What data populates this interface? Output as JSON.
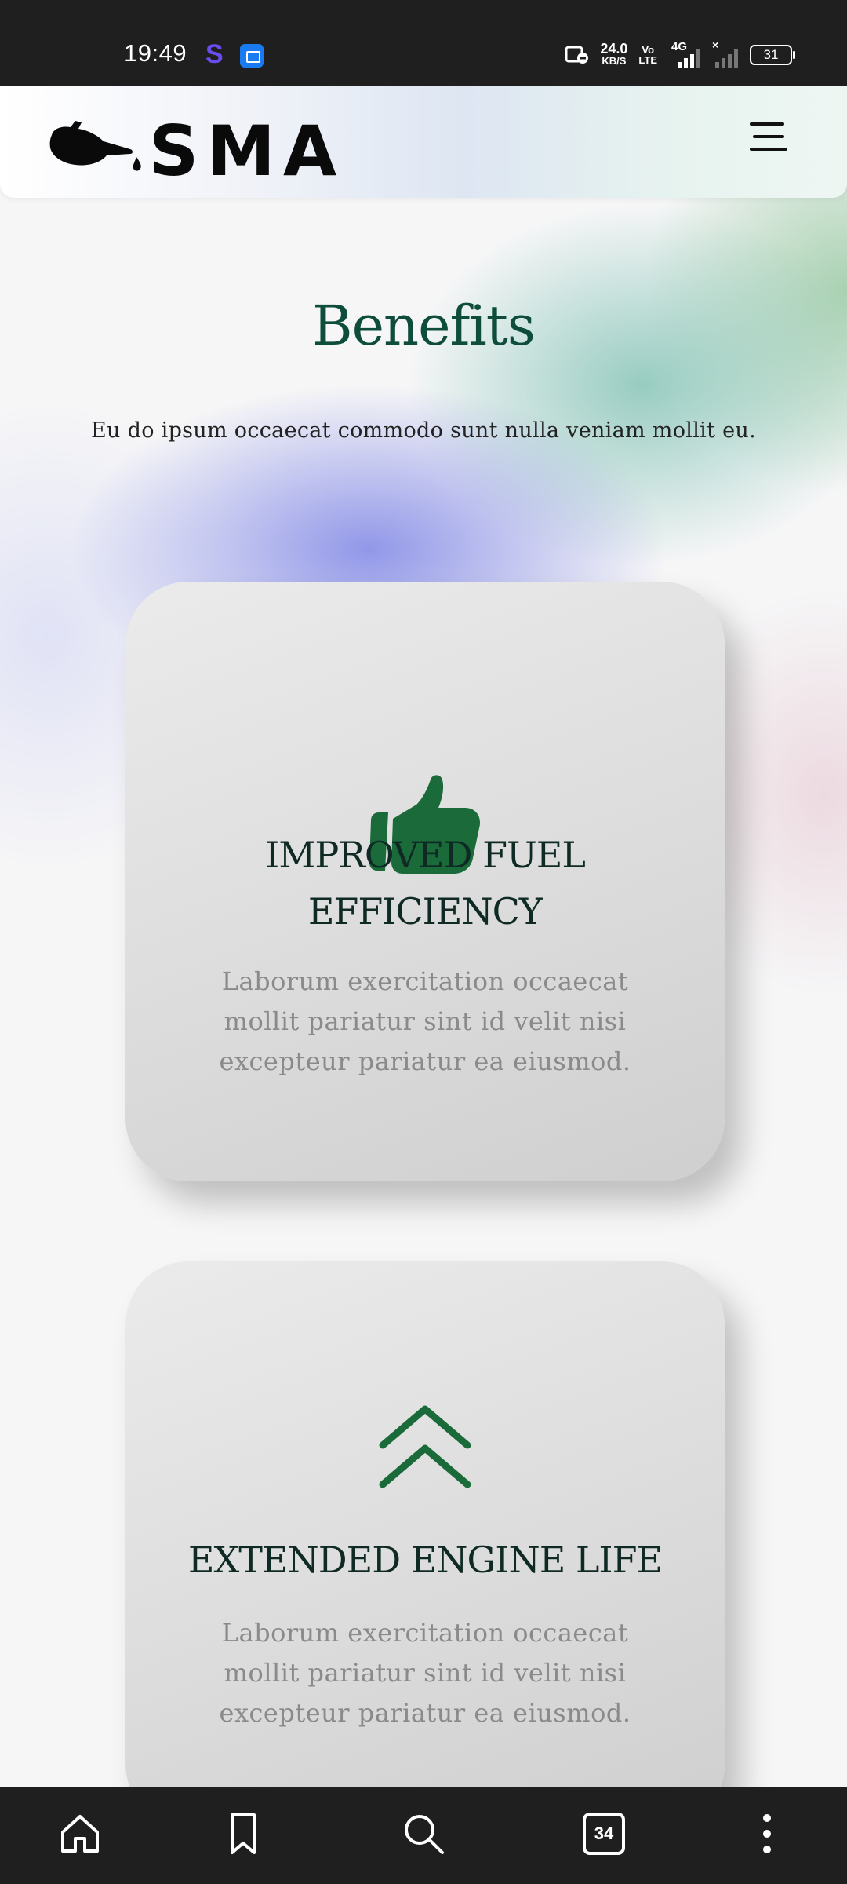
{
  "status_bar": {
    "time": "19:49",
    "network_speed_value": "24.0",
    "network_speed_unit": "KB/S",
    "volte_top": "Vo",
    "volte_bottom": "LTE",
    "network_type": "4G",
    "battery": "31"
  },
  "header": {
    "logo_text": "SMA",
    "logo_icon": "oil-can-icon",
    "menu_icon": "hamburger-menu-icon"
  },
  "section": {
    "title": "Benefits",
    "subtitle": "Eu do ipsum occaecat commodo sunt nulla veniam mollit eu."
  },
  "cards": [
    {
      "icon": "thumbs-up-icon",
      "title": "IMPROVED FUEL EFFICIENCY",
      "text": "Laborum exercitation occaecat mollit pariatur sint id velit nisi excepteur pariatur ea eiusmod."
    },
    {
      "icon": "double-chevron-up-icon",
      "title": "EXTENDED ENGINE LIFE",
      "text": "Laborum exercitation occaecat mollit pariatur sint id velit nisi excepteur pariatur ea eiusmod."
    }
  ],
  "bottom_bar": {
    "home_icon": "home-icon",
    "bookmark_icon": "bookmark-icon",
    "search_icon": "search-icon",
    "tabs_count": "34",
    "more_icon": "more-vertical-icon"
  },
  "colors": {
    "accent_green": "#1b6b3a",
    "title_green": "#0e4d3b",
    "status_bar_bg": "#1f1f1f"
  }
}
